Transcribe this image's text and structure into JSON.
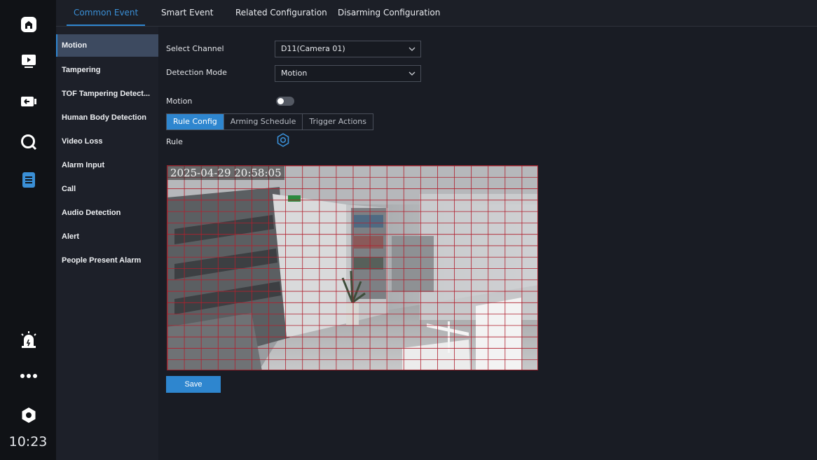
{
  "clock": "10:23",
  "rail": {
    "icons": [
      "home-icon",
      "playback-icon",
      "backup-icon",
      "search-icon",
      "event-config-icon",
      "alarm-icon",
      "more-icon",
      "settings-icon"
    ]
  },
  "top_tabs": [
    {
      "label": "Common Event",
      "active": true
    },
    {
      "label": "Smart Event",
      "active": false
    },
    {
      "label": "Related Configuration",
      "active": false
    },
    {
      "label": "Disarming Configuration",
      "active": false
    }
  ],
  "submenu": [
    {
      "label": "Motion",
      "active": true
    },
    {
      "label": "Tampering",
      "active": false
    },
    {
      "label": "TOF Tampering Detect...",
      "active": false
    },
    {
      "label": "Human Body Detection",
      "active": false
    },
    {
      "label": "Video Loss",
      "active": false
    },
    {
      "label": "Alarm Input",
      "active": false
    },
    {
      "label": "Call",
      "active": false
    },
    {
      "label": "Audio Detection",
      "active": false
    },
    {
      "label": "Alert",
      "active": false
    },
    {
      "label": "People Present Alarm",
      "active": false
    }
  ],
  "form": {
    "channel_label": "Select Channel",
    "channel_value": "D11(Camera 01)",
    "mode_label": "Detection Mode",
    "mode_value": "Motion",
    "motion_label": "Motion",
    "motion_enabled": false,
    "rule_label": "Rule"
  },
  "sub_tabs": [
    {
      "label": "Rule Config",
      "active": true
    },
    {
      "label": "Arming Schedule",
      "active": false
    },
    {
      "label": "Trigger Actions",
      "active": false
    }
  ],
  "video": {
    "osd_timestamp": "2025-04-29 20:58:05",
    "grid_cols": 22,
    "grid_rows": 18,
    "grid_color": "#b0202e"
  },
  "save_label": "Save",
  "colors": {
    "accent": "#2e86cf",
    "rail_bg": "#101216",
    "content_bg": "#191c24"
  }
}
